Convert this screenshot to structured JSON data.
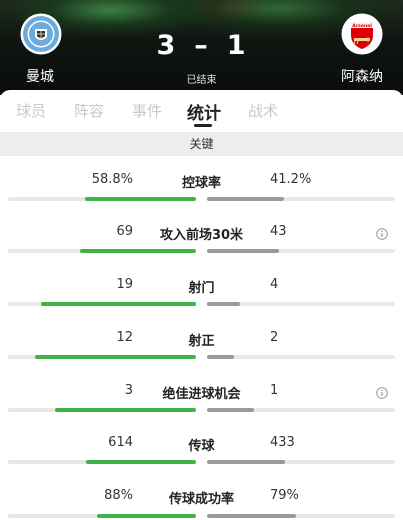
{
  "match": {
    "home_team": "曼城",
    "away_team": "阿森纳",
    "home_score": "3",
    "separator": "–",
    "away_score": "1",
    "status": "已结束",
    "home_badge_icon": "manchester-city-crest-icon",
    "away_badge_icon": "arsenal-crest-icon",
    "away_badge_text": "Arsenal"
  },
  "tabs": [
    {
      "label": "球员",
      "active": false
    },
    {
      "label": "阵容",
      "active": false
    },
    {
      "label": "事件",
      "active": false
    },
    {
      "label": "统计",
      "active": true
    },
    {
      "label": "战术",
      "active": false
    }
  ],
  "section": {
    "title": "关键"
  },
  "colors": {
    "home_bar": "#3fb34a",
    "away_bar": "#9a9a9a",
    "track": "#e8e8e8"
  },
  "stats": [
    {
      "label": "控球率",
      "home": "58.8%",
      "away": "41.2%",
      "home_fill": 0.588,
      "away_fill": 0.412,
      "info": false
    },
    {
      "label": "攻入前场30米",
      "home": "69",
      "away": "43",
      "home_fill": 0.616,
      "away_fill": 0.384,
      "info": true
    },
    {
      "label": "射门",
      "home": "19",
      "away": "4",
      "home_fill": 0.826,
      "away_fill": 0.174,
      "info": false
    },
    {
      "label": "射正",
      "home": "12",
      "away": "2",
      "home_fill": 0.857,
      "away_fill": 0.143,
      "info": false
    },
    {
      "label": "绝佳进球机会",
      "home": "3",
      "away": "1",
      "home_fill": 0.75,
      "away_fill": 0.25,
      "info": true
    },
    {
      "label": "传球",
      "home": "614",
      "away": "433",
      "home_fill": 0.586,
      "away_fill": 0.414,
      "info": false
    },
    {
      "label": "传球成功率",
      "home": "88%",
      "away": "79%",
      "home_fill": 0.527,
      "away_fill": 0.473,
      "info": false
    }
  ]
}
